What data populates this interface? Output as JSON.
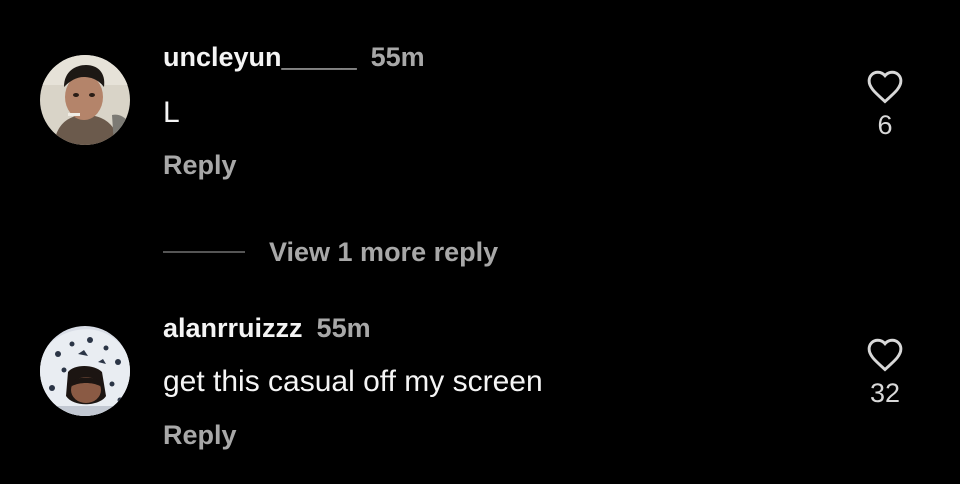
{
  "comments": [
    {
      "username": "uncleyun_____",
      "time": "55m",
      "text": "L",
      "reply_label": "Reply",
      "like_count": "6",
      "avatar_icon": "user-avatar-photo"
    },
    {
      "username": "alanrruizzz",
      "time": "55m",
      "text": "get this casual off my screen",
      "reply_label": "Reply",
      "like_count": "32",
      "avatar_icon": "user-avatar-photo"
    }
  ],
  "thread": {
    "view_more_label": "View 1 more reply"
  },
  "colors": {
    "background": "#000000",
    "primary_text": "#f5f5f5",
    "secondary_text": "#a8a8a8"
  }
}
